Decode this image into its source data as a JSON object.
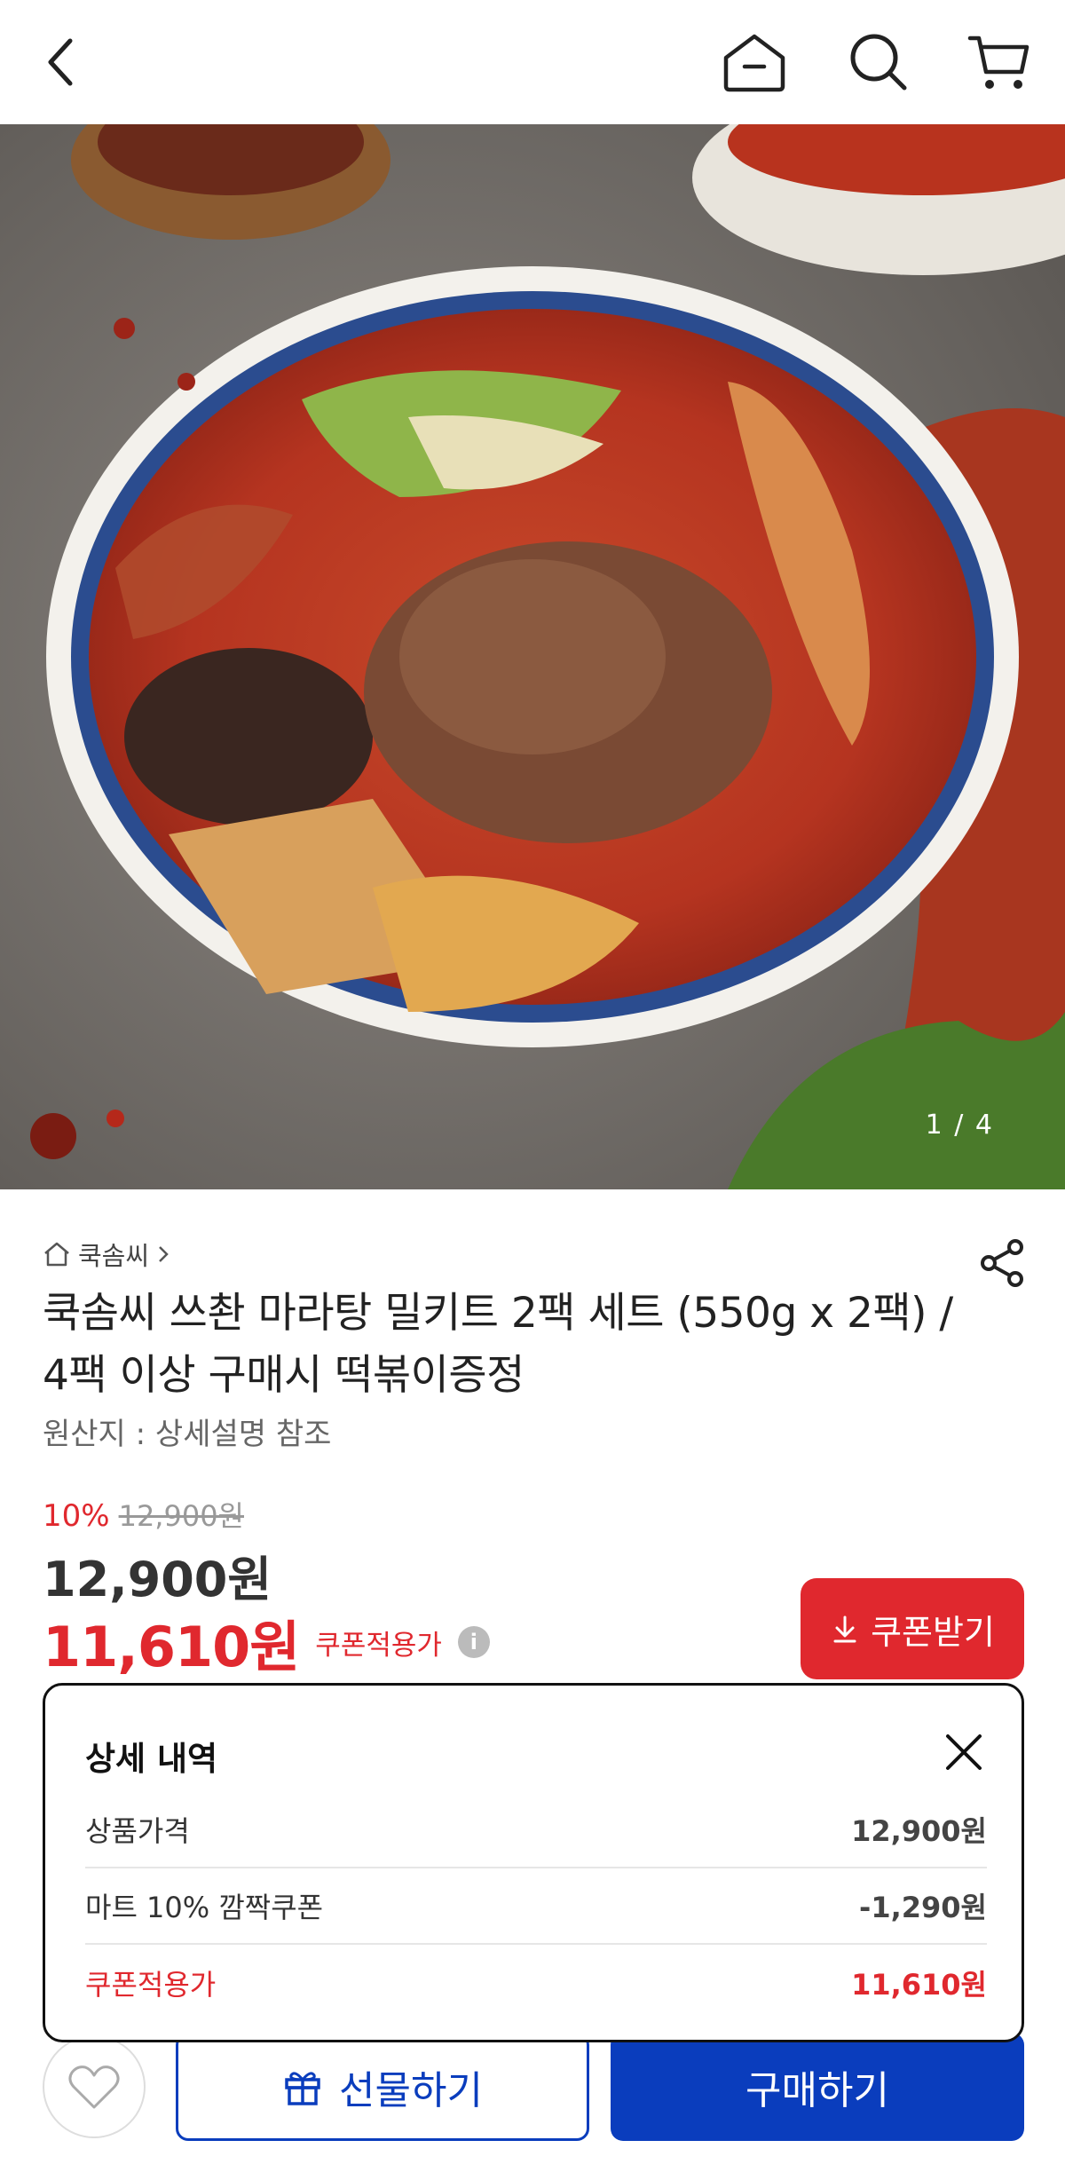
{
  "nav": {
    "back_icon": "chevron-left-icon",
    "home_icon": "home-icon",
    "search_icon": "search-icon",
    "cart_icon": "cart-icon"
  },
  "hero": {
    "page_indicator": "1 / 4"
  },
  "product": {
    "brand": "쿡솜씨",
    "title": "쿡솜씨 쓰촨 마라탕 밀키트 2팩 세트 (550g x 2팩) / 4팩 이상 구매시 떡볶이증정",
    "origin": "원산지 : 상세설명 참조",
    "discount_rate": "10%",
    "original_price": "12,900원",
    "price": "12,900원",
    "coupon_price": "11,610원",
    "coupon_price_label": "쿠폰적용가",
    "coupon_button": "쿠폰받기"
  },
  "popup": {
    "title": "상세 내역",
    "rows": [
      {
        "label": "상품가격",
        "value": "12,900원"
      },
      {
        "label": "마트 10% 깜짝쿠폰",
        "value": "-1,290원"
      },
      {
        "label": "쿠폰적용가",
        "value": "11,610원"
      }
    ]
  },
  "bottom": {
    "gift_label": "선물하기",
    "buy_label": "구매하기"
  },
  "colors": {
    "accent_red": "#e0282e",
    "primary_blue": "#0a3dbd"
  }
}
